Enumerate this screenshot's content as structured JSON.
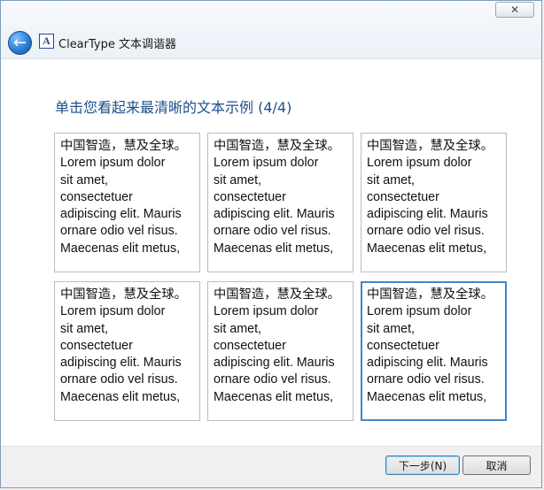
{
  "window": {
    "title": "ClearType 文本调谐器",
    "close_label": "✕",
    "back_label": "←",
    "app_icon_text": "A",
    "icons": {
      "back": "back-arrow-icon",
      "app": "cleartype-app-icon",
      "close": "close-icon"
    }
  },
  "page": {
    "heading": "单击您看起来最清晰的文本示例 (4/4)"
  },
  "samples": [
    {
      "text": "中国智造，慧及全球。\nLorem ipsum dolor\nsit amet,\nconsectetuer\nadipiscing elit. Mauris\nornare odio vel risus.\nMaecenas elit metus,"
    },
    {
      "text": "中国智造，慧及全球。\nLorem ipsum dolor\nsit amet,\nconsectetuer\nadipiscing elit. Mauris\nornare odio vel risus.\nMaecenas elit metus,"
    },
    {
      "text": "中国智造，慧及全球。\nLorem ipsum dolor\nsit amet,\nconsectetuer\nadipiscing elit. Mauris\nornare odio vel risus.\nMaecenas elit metus,"
    },
    {
      "text": "中国智造，慧及全球。\nLorem ipsum dolor\nsit amet,\nconsectetuer\nadipiscing elit. Mauris\nornare odio vel risus.\nMaecenas elit metus,"
    },
    {
      "text": "中国智造，慧及全球。\nLorem ipsum dolor\nsit amet,\nconsectetuer\nadipiscing elit. Mauris\nornare odio vel risus.\nMaecenas elit metus,"
    },
    {
      "text": "中国智造，慧及全球。\nLorem ipsum dolor\nsit amet,\nconsectetuer\nadipiscing elit. Mauris\nornare odio vel risus.\nMaecenas elit metus,"
    }
  ],
  "selection": {
    "selected_sample_number": 6
  },
  "footer": {
    "next_label": "下一步(N)",
    "cancel_label": "取消"
  },
  "colors": {
    "heading": "#1d4f8a",
    "selected_border": "#3f87c8",
    "window_border": "#7f9db9"
  }
}
